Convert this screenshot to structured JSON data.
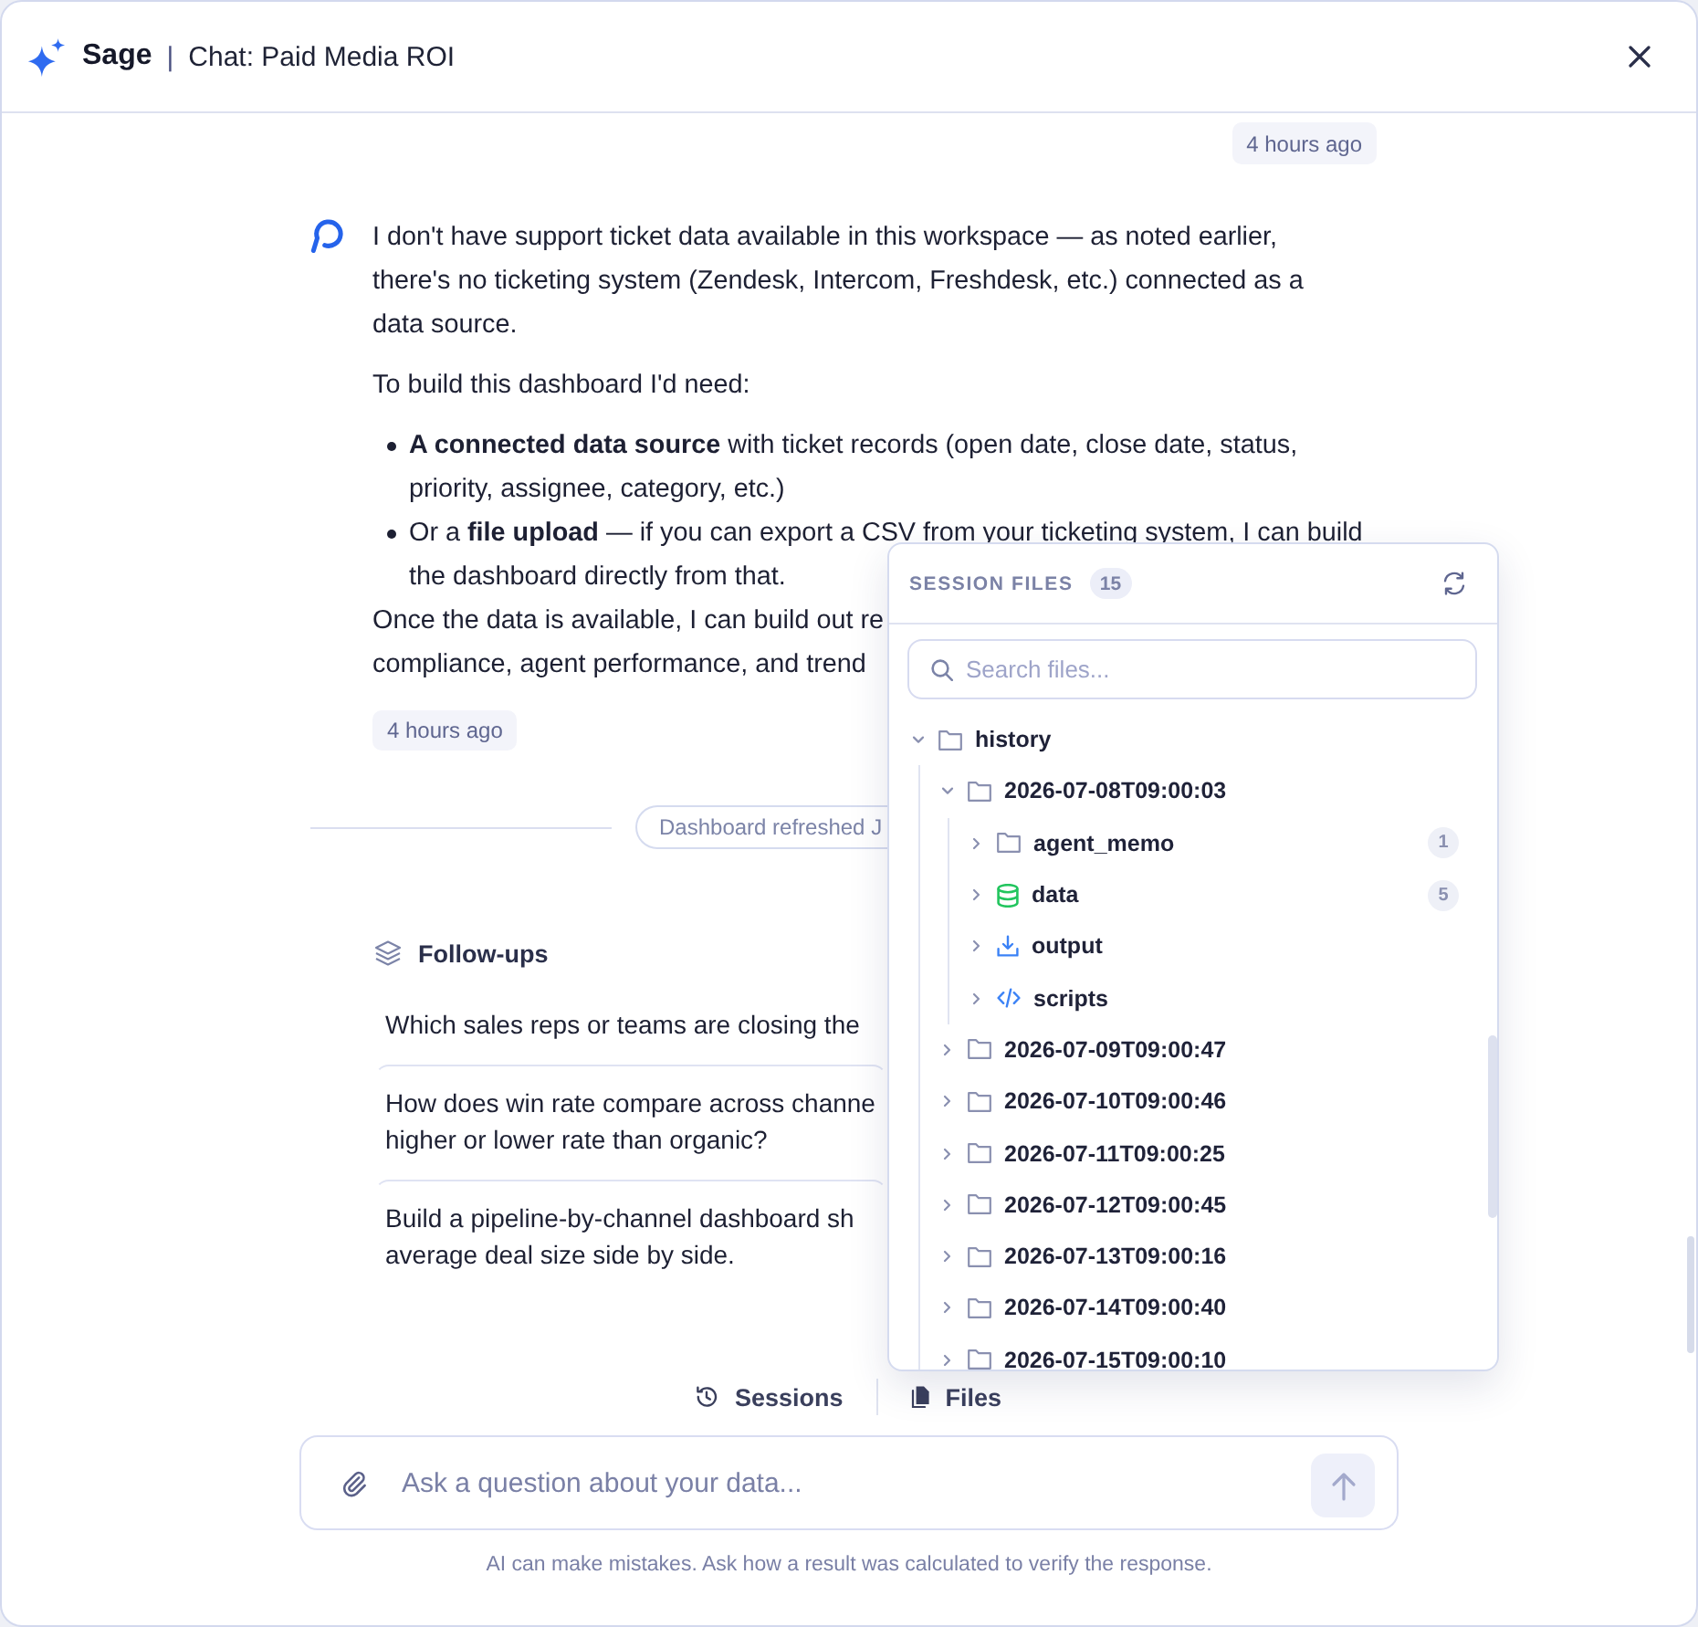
{
  "window": {
    "brand": "Sage",
    "separator": "|",
    "title": "Chat: Paid Media ROI"
  },
  "conversation": {
    "user_timestamp": "4 hours ago",
    "assistant_message": {
      "blocks": [
        {
          "kind": "paragraph",
          "text": "I don't have support ticket data available in this workspace — as noted earlier,\nthere's no ticketing system (Zendesk, Intercom, Freshdesk, etc.) connected as a\ndata source."
        },
        {
          "kind": "paragraph",
          "text": "To build this dashboard I'd need:"
        },
        {
          "kind": "list",
          "items": [
            {
              "lines": [
                "**A connected data source** with ticket records (open date, close date, status,",
                "priority, assignee, category, etc.)"
              ]
            },
            {
              "lines": [
                "Or a **file upload** — if you can export a CSV from your ticketing system, I can build",
                "the dashboard directly from that."
              ]
            }
          ]
        },
        {
          "kind": "paragraph",
          "text": "Once the data is available, I can build out re\ncompliance, agent performance, and trend"
        }
      ],
      "timestamp": "4 hours ago"
    },
    "event": {
      "label": "Dashboard refreshed J"
    },
    "follow_ups": {
      "title": "Follow-ups",
      "items": [
        "Which sales reps or teams are closing the",
        "How does win rate compare across channe\nhigher or lower rate than organic?",
        "Build a pipeline-by-channel dashboard sh\naverage deal size side by side."
      ]
    }
  },
  "session_files": {
    "title": "SESSION FILES",
    "count": "15",
    "search": {
      "placeholder": "Search files..."
    },
    "tree": [
      {
        "name": "history",
        "kind": "folder",
        "expanded": true,
        "children": [
          {
            "name": "2026-07-08T09:00:03",
            "kind": "folder",
            "expanded": true,
            "children": [
              {
                "name": "agent_memo",
                "kind": "folder",
                "expanded": false,
                "count": "1"
              },
              {
                "name": "data",
                "kind": "database",
                "expanded": false,
                "count": "5"
              },
              {
                "name": "output",
                "kind": "download",
                "expanded": false
              },
              {
                "name": "scripts",
                "kind": "code",
                "expanded": false
              }
            ]
          },
          {
            "name": "2026-07-09T09:00:47",
            "kind": "folder",
            "expanded": false
          },
          {
            "name": "2026-07-10T09:00:46",
            "kind": "folder",
            "expanded": false
          },
          {
            "name": "2026-07-11T09:00:25",
            "kind": "folder",
            "expanded": false
          },
          {
            "name": "2026-07-12T09:00:45",
            "kind": "folder",
            "expanded": false
          },
          {
            "name": "2026-07-13T09:00:16",
            "kind": "folder",
            "expanded": false
          },
          {
            "name": "2026-07-14T09:00:40",
            "kind": "folder",
            "expanded": false
          },
          {
            "name": "2026-07-15T09:00:10",
            "kind": "folder",
            "expanded": false
          }
        ]
      }
    ]
  },
  "footer": {
    "tabs": [
      {
        "label": "Sessions",
        "kind": "sessions"
      },
      {
        "label": "Files",
        "kind": "files"
      }
    ],
    "input": {
      "placeholder": "Ask a question about your data..."
    },
    "disclaimer": "AI can make mistakes. Ask how a result was calculated to verify the response."
  }
}
